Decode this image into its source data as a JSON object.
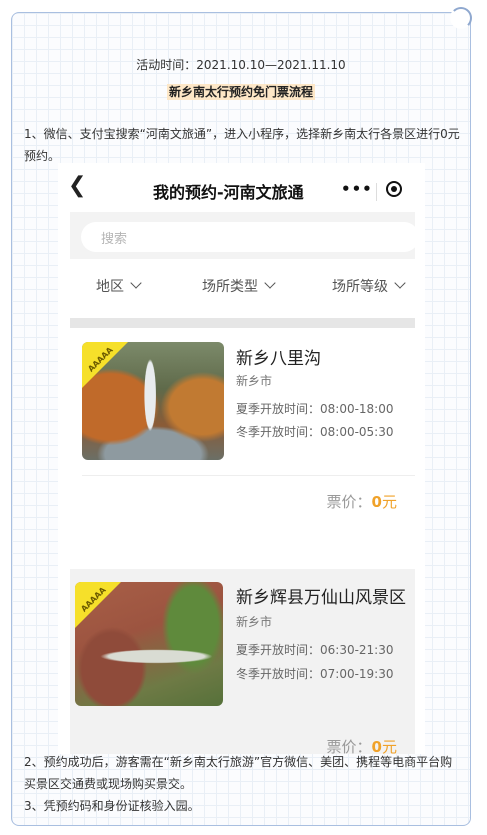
{
  "activity_time": "活动时间：2021.10.10—2021.11.10",
  "title": "新乡南太行预约免门票流程",
  "step1": "1、微信、支付宝搜索“河南文旅通”，进入小程序，选择新乡南太行各景区进行0元预约。",
  "app": {
    "back_icon": "chevron-left-icon",
    "title": "我的预约-河南文旅通",
    "more_label": "•••",
    "search_placeholder": "搜索",
    "filters": [
      "地区",
      "场所类型",
      "场所等级"
    ],
    "items": [
      {
        "badge": "AAAAA",
        "name": "新乡八里沟",
        "city": "新乡市",
        "summer": "夏季开放时间：08:00-18:00",
        "winter": "冬季开放时间：08:00-05:30",
        "price_label": "票价：",
        "price_value": "0",
        "price_unit": "元"
      },
      {
        "badge": "AAAAA",
        "name": "新乡辉县万仙山风景区",
        "city": "新乡市",
        "summer": "夏季开放时间：06:30-21:30",
        "winter": "冬季开放时间：07:00-19:30",
        "price_label": "票价：",
        "price_value": "0",
        "price_unit": "元"
      }
    ]
  },
  "step2": "2、预约成功后，游客需在“新乡南太行旅游”官方微信、美团、携程等电商平台购买景区交通费或现场购买景交。",
  "step3": "3、凭预约码和身份证核验入园。",
  "colors": {
    "accent": "#f0a22a",
    "badge": "#f6e02a",
    "highlight": "#fde7c7"
  }
}
